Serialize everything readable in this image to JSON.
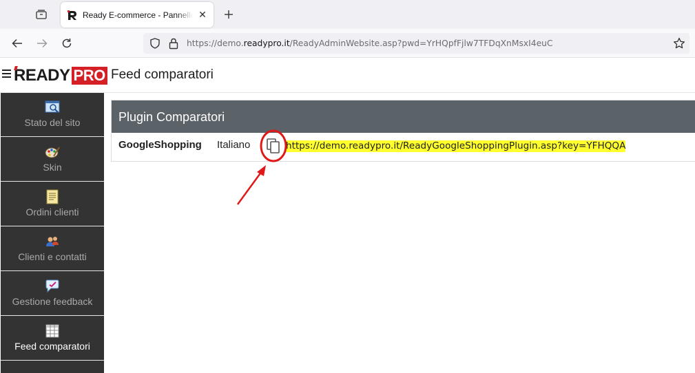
{
  "browser": {
    "tab_title": "Ready E-commerce - Pannello amministrazione",
    "url_prefix": "https://demo.",
    "url_domain": "readypro.it",
    "url_suffix": "/ReadyAdminWebsite.asp?pwd=YrHQpfFjlw7TFDqXnMsxI4euC"
  },
  "header": {
    "logo_ready": "READY",
    "logo_pro": "PRO",
    "page_title": "Feed comparatori"
  },
  "sidebar": {
    "items": [
      {
        "label": "Stato del sito",
        "icon": "site-status-icon"
      },
      {
        "label": "Skin",
        "icon": "palette-icon"
      },
      {
        "label": "Ordini clienti",
        "icon": "orders-icon"
      },
      {
        "label": "Clienti e contatti",
        "icon": "contacts-icon"
      },
      {
        "label": "Gestione feedback",
        "icon": "feedback-icon"
      },
      {
        "label": "Feed comparatori",
        "icon": "grid-icon",
        "active": true
      }
    ]
  },
  "panel": {
    "title": "Plugin Comparatori",
    "rows": [
      {
        "name": "GoogleShopping",
        "language": "Italiano",
        "url": "https://demo.readypro.it/ReadyGoogleShoppingPlugin.asp?key=YFHQQA"
      }
    ]
  },
  "colors": {
    "sidebar_bg": "#333333",
    "panel_header_bg": "#5b6268",
    "brand_red": "#d41f26",
    "url_highlight": "#ffff2e",
    "annotation_red": "#e01818"
  }
}
